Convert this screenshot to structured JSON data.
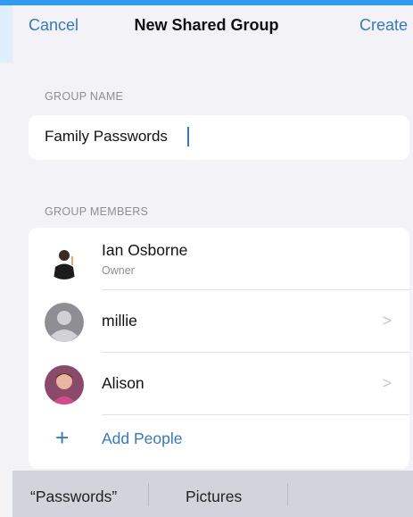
{
  "nav": {
    "cancel_label": "Cancel",
    "title": "New Shared Group",
    "create_label": "Create"
  },
  "group_name": {
    "section_label": "GROUP NAME",
    "value": "Family Passwords"
  },
  "group_members": {
    "section_label": "GROUP MEMBERS",
    "members": [
      {
        "name": "Ian Osborne",
        "role": "Owner",
        "avatar": "photo-avatar",
        "chevron": false
      },
      {
        "name": "millie",
        "role": "",
        "avatar": "default-person-icon",
        "chevron": true
      },
      {
        "name": "Alison",
        "role": "",
        "avatar": "photo-avatar",
        "chevron": true
      }
    ],
    "add_label": "Add People",
    "add_icon": "plus-icon",
    "chevron_glyph": ">"
  },
  "keyboard_suggestions": {
    "items": [
      "“Passwords”",
      "Pictures",
      ""
    ]
  },
  "colors": {
    "accent": "#3478c8",
    "background": "#f2f2f7",
    "card": "#ffffff",
    "secondary_text": "#8e8e93",
    "suggestion_bar": "#d1d4da"
  }
}
